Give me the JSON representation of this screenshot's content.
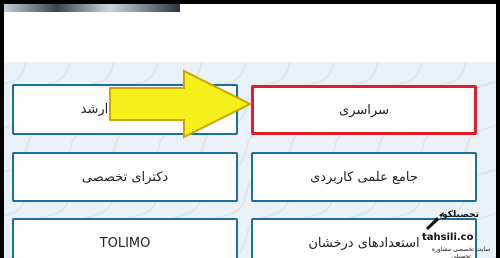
{
  "buttons": {
    "sarasari": "سراسری",
    "arshad": "کارشناسی ارشد",
    "jame_elmi_karbordi": "جامع علمی کاربردی",
    "doctora_takhasosi": "دکترای تخصصی",
    "estedad_derakhshan": "استعدادهای درخشان",
    "tolimo": "TOLIMO"
  },
  "colors": {
    "button_border": "#1c6fa1",
    "highlight_border": "#e21d2a",
    "arrow_fill": "#f5ef1b",
    "arrow_stroke": "#d3a300",
    "background": "#eaf2f7"
  },
  "watermark": {
    "logo_text": "تحصیلکو",
    "domain": "tahsili.co",
    "tagline": "سایت تخصصی مشاوره تحصیلی",
    "icon": "rocket-icon"
  }
}
